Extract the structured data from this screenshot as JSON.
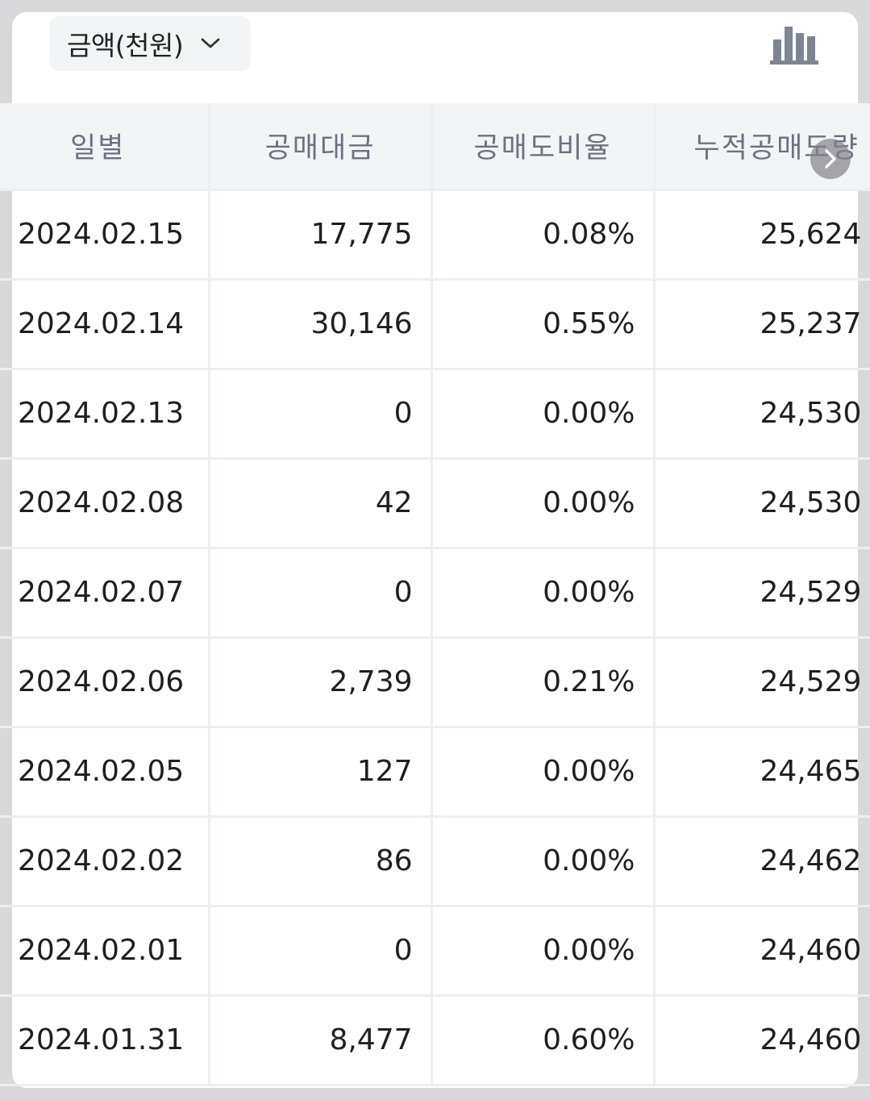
{
  "unit_selector": {
    "label": "금액(천원)",
    "chevron_icon": "chevron-down-icon"
  },
  "chart_toggle": {
    "icon": "bar-chart-icon"
  },
  "table": {
    "headers": [
      "일별",
      "공매대금",
      "공매도비율",
      "누적공매도량"
    ],
    "rows": [
      {
        "date": "2024.02.15",
        "amount": "17,775",
        "ratio": "0.08%",
        "cumulative": "25,624"
      },
      {
        "date": "2024.02.14",
        "amount": "30,146",
        "ratio": "0.55%",
        "cumulative": "25,237"
      },
      {
        "date": "2024.02.13",
        "amount": "0",
        "ratio": "0.00%",
        "cumulative": "24,530"
      },
      {
        "date": "2024.02.08",
        "amount": "42",
        "ratio": "0.00%",
        "cumulative": "24,530"
      },
      {
        "date": "2024.02.07",
        "amount": "0",
        "ratio": "0.00%",
        "cumulative": "24,529"
      },
      {
        "date": "2024.02.06",
        "amount": "2,739",
        "ratio": "0.21%",
        "cumulative": "24,529"
      },
      {
        "date": "2024.02.05",
        "amount": "127",
        "ratio": "0.00%",
        "cumulative": "24,465"
      },
      {
        "date": "2024.02.02",
        "amount": "86",
        "ratio": "0.00%",
        "cumulative": "24,462"
      },
      {
        "date": "2024.02.01",
        "amount": "0",
        "ratio": "0.00%",
        "cumulative": "24,460"
      },
      {
        "date": "2024.01.31",
        "amount": "8,477",
        "ratio": "0.60%",
        "cumulative": "24,460"
      }
    ]
  },
  "scroll_button": {
    "icon": "chevron-right-icon"
  },
  "colors": {
    "header_bg": "#f3f4f6",
    "header_text": "#6b7280",
    "cell_text": "#1f1f1f",
    "divider": "#eceef1",
    "icon_gray": "#7d8593"
  }
}
